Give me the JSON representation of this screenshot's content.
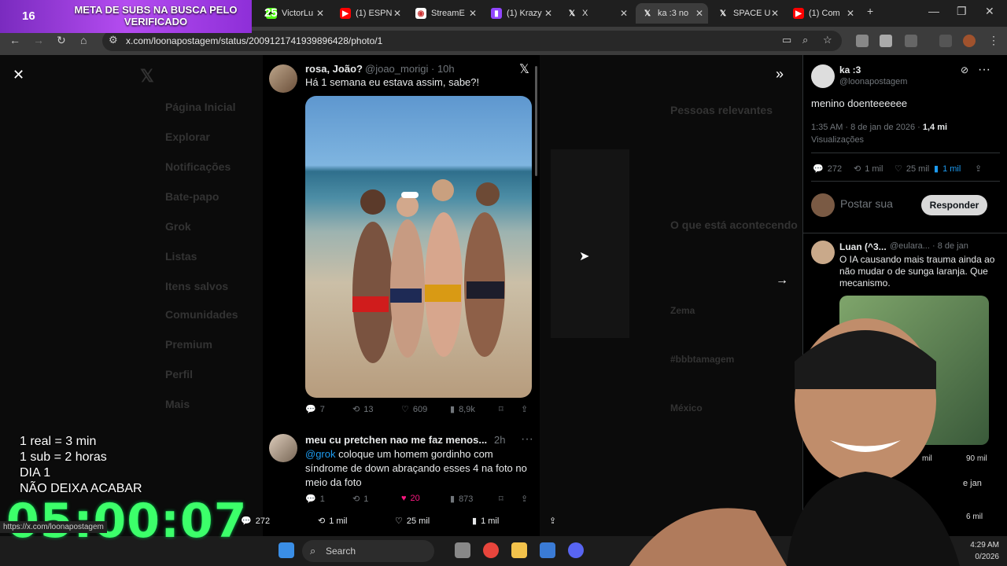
{
  "banner": {
    "left_count": "16",
    "title": "META DE SUBS NA BUSCA PELO VERIFICADO",
    "right_count": "25"
  },
  "tabs": [
    {
      "label": "VictorLu",
      "icon": "kick-icon"
    },
    {
      "label": "(1) ESPN",
      "icon": "youtube-icon"
    },
    {
      "label": "StreamE",
      "icon": "streamelements-icon"
    },
    {
      "label": "(1) Krazy",
      "icon": "twitch-icon"
    },
    {
      "label": "X",
      "icon": "x-icon"
    },
    {
      "label": "ka :3 no",
      "icon": "x-icon"
    },
    {
      "label": "SPACE U",
      "icon": "x-icon"
    },
    {
      "label": "(1) Com",
      "icon": "youtube-icon"
    }
  ],
  "address": {
    "url": "x.com/loonapostagem/status/2009121741939896428/photo/1"
  },
  "ghost_nav": [
    "Página Inicial",
    "Explorar",
    "Notificações",
    "Bate-papo",
    "Grok",
    "Listas",
    "Itens salvos",
    "Comunidades",
    "Premium",
    "Perfil",
    "Mais"
  ],
  "ghost_side": {
    "relevant": "Pessoas relevantes",
    "happening": "O que está acontecendo",
    "trends": [
      "Zema",
      "#bbbtamagem",
      "México"
    ]
  },
  "post": {
    "author_name": "rosa, João?",
    "author_handle": "@joao_morigi · 10h",
    "text": "Há 1 semana eu estava assim, sabe?!",
    "replies": "7",
    "reposts": "13",
    "likes": "609",
    "views": "8,9k"
  },
  "reply": {
    "author_name": "meu cu pretchen nao me faz menos...",
    "time": "2h",
    "mention": "@grok",
    "text": " coloque um homem gordinho com síndrome de down abraçando esses 4 na foto no meio da foto",
    "replies": "1",
    "reposts": "1",
    "likes": "20",
    "views": "873"
  },
  "viewer_bar": {
    "replies": "272",
    "reposts": "1 mil",
    "likes": "25 mil",
    "views": "1 mil"
  },
  "side": {
    "name": "ka :3",
    "handle": "@loonapostagem",
    "text": "menino doenteeeeee",
    "meta_time": "1:35 AM · 8 de jan de 2026 · ",
    "meta_views": "1,4 mi",
    "meta_views_label": "Visualizações",
    "replies": "272",
    "reposts": "1 mil",
    "likes": "25 mil",
    "bookmarks": "1 mil",
    "compose_placeholder": "Postar sua",
    "reply_button": "Responder",
    "comment_name": "Luan (^3...",
    "comment_handle": "@eulara... · 8 de jan",
    "comment_text": "O IA causando mais trauma ainda ao não mudar o de sunga laranja. Que mecanismo.",
    "comment2_stats_a": "mil",
    "comment2_stats_b": "90 mil",
    "comment3_time": "e jan",
    "comment3_stat": "6 mil"
  },
  "overlay": {
    "lines": [
      "1 real = 3 min",
      "1 sub = 2 horas",
      "DIA 1",
      "NÃO DEIXA ACABAR"
    ],
    "timer": "05:00:07",
    "status_url": "https://x.com/loonapostagem"
  },
  "taskbar": {
    "search_label": "Search",
    "time": "4:29 AM",
    "date": "0/2026"
  }
}
